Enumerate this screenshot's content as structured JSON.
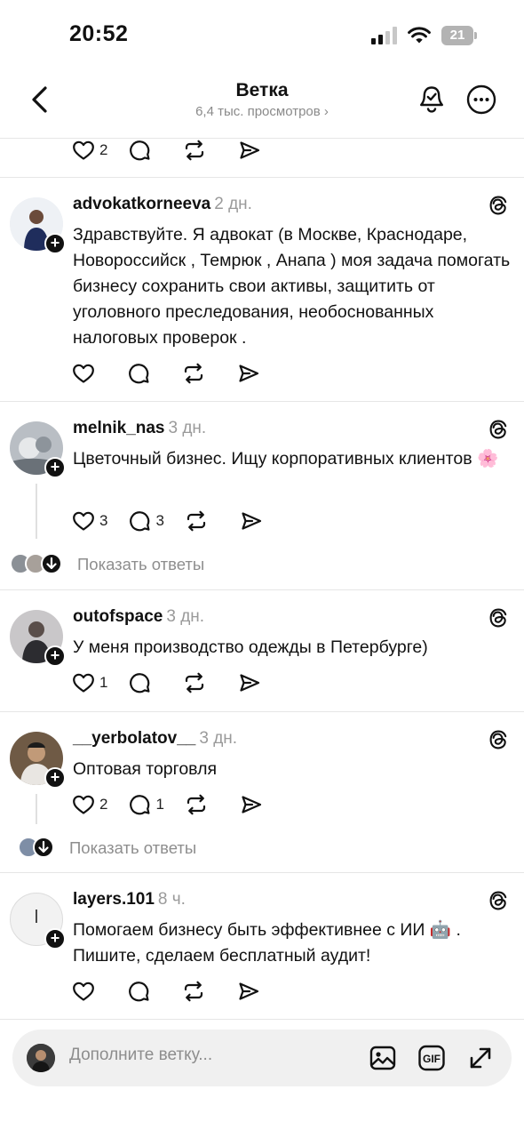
{
  "status_bar": {
    "time": "20:52",
    "battery": "21"
  },
  "header": {
    "title": "Ветка",
    "subtitle": "6,4 тыс. просмотров ›"
  },
  "top_post_actions": {
    "likes": "2"
  },
  "posts": [
    {
      "username": "advokatkorneeva",
      "time": "2 дн.",
      "text": "Здравствуйте. Я адвокат (в Москве, Краснодаре, Новороссийск , Темрюк , Анапа ) моя задача помогать бизнесу сохранить свои активы, защитить от уголовного преследования, необоснованных налоговых проверок .",
      "likes": "",
      "replies": ""
    },
    {
      "username": "melnik_nas",
      "time": "3 дн.",
      "text": "Цветочный бизнес. Ищу корпоративных клиентов 🌸",
      "likes": "3",
      "replies": "3",
      "show_replies": "Показать ответы"
    },
    {
      "username": "outofspace",
      "time": "3 дн.",
      "text": "У меня производство одежды в Петербурге)",
      "likes": "1",
      "replies": ""
    },
    {
      "username": "__yerbolatov__",
      "time": "3 дн.",
      "text": "Оптовая торговля",
      "likes": "2",
      "replies": "1",
      "show_replies": "Показать ответы"
    },
    {
      "username": "layers.101",
      "time": "8 ч.",
      "avatar_letter": "l",
      "text": "Помогаем бизнесу быть эффективнее с ИИ 🤖 . Пишите, сделаем бесплатный аудит!",
      "likes": "",
      "replies": ""
    }
  ],
  "composer": {
    "placeholder": "Дополните ветку..."
  },
  "icons": {
    "back": "chevron-left-icon",
    "notify": "bell-icon",
    "more": "more-horizontal-icon",
    "threads": "threads-logo-icon",
    "like": "heart-icon",
    "reply": "comment-icon",
    "repost": "repost-icon",
    "share": "send-icon",
    "image": "image-icon",
    "gif": "gif-icon",
    "expand": "expand-icon"
  },
  "colors": {
    "text": "#111111",
    "muted": "#8e8e8e",
    "divider": "#e6e6e6",
    "composer_bg": "#f0f0f0"
  }
}
